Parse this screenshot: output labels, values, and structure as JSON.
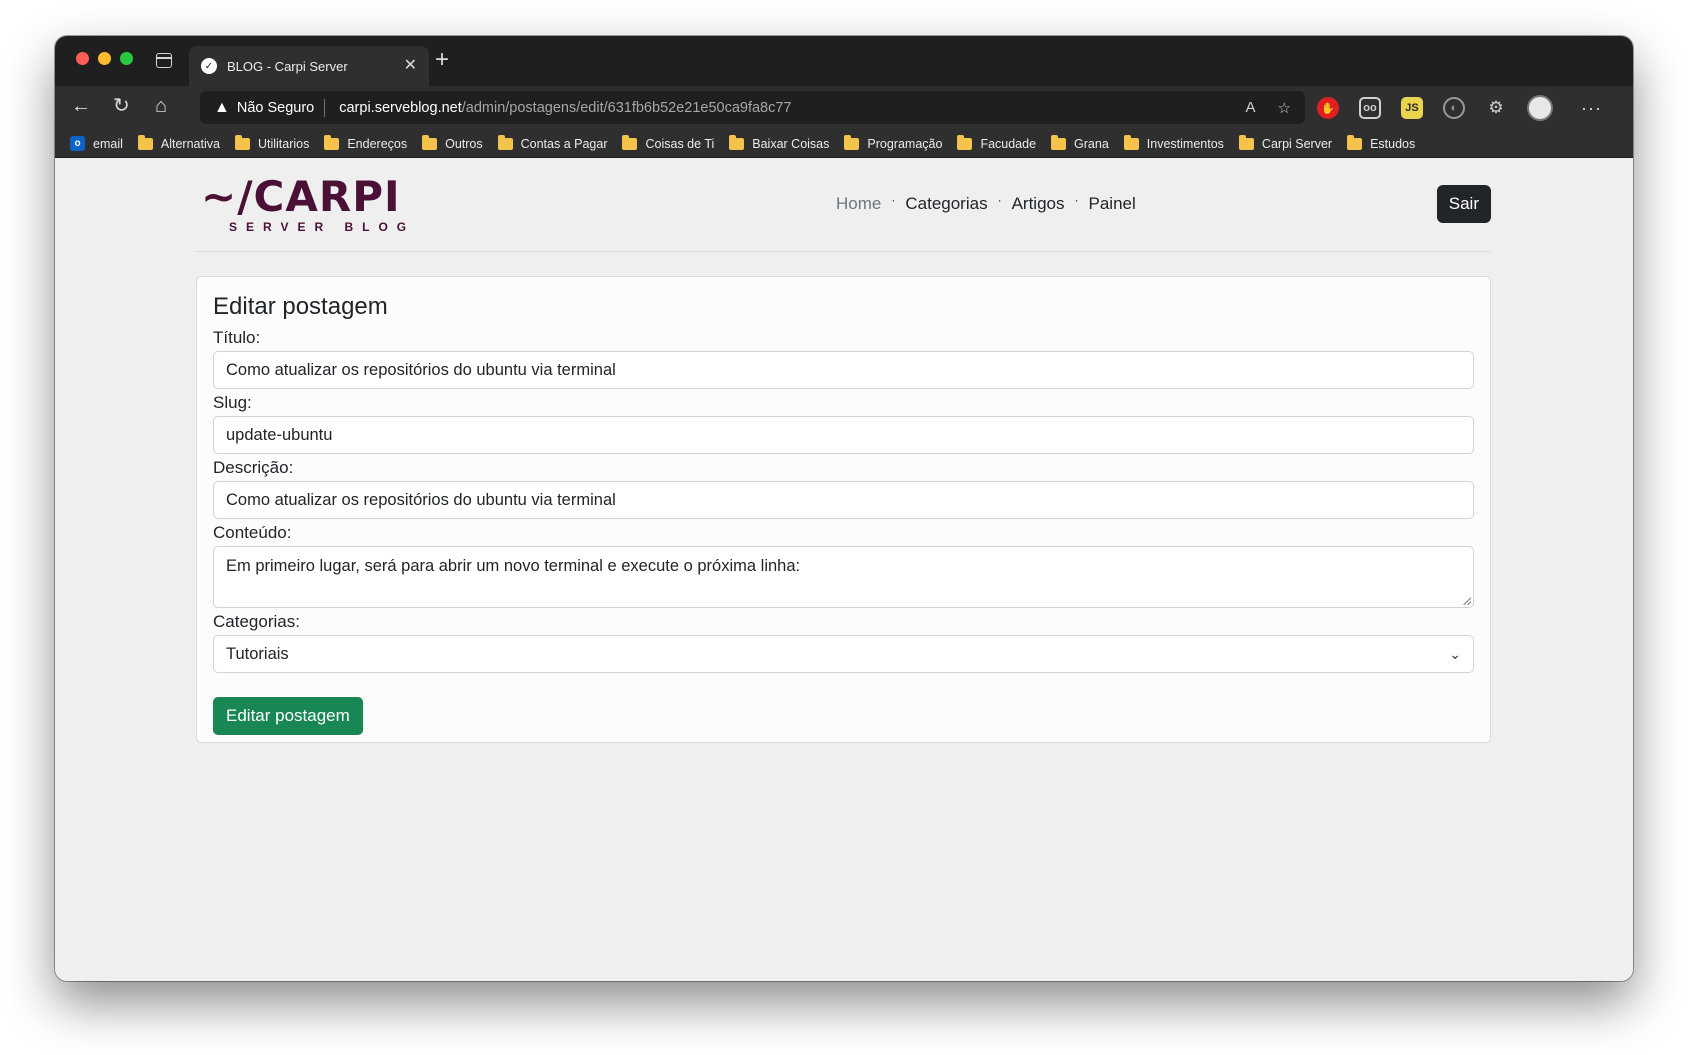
{
  "browser": {
    "tab_title": "BLOG - Carpi Server",
    "tab_favicon": "✓",
    "address": {
      "security_label": "Não Seguro",
      "url_host": "carpi.serveblog.net",
      "url_path": "/admin/postagens/edit/631fb6b52e21e50ca9fa8c77"
    },
    "extensions": {
      "ext_grey_label": "oo",
      "ext_yellow_label": "JS"
    },
    "bookmarks": [
      {
        "label": "email",
        "icon": "outlook-icon"
      },
      {
        "label": "Alternativa",
        "icon": "folder-icon"
      },
      {
        "label": "Utilitarios",
        "icon": "folder-icon"
      },
      {
        "label": "Endereços",
        "icon": "folder-icon"
      },
      {
        "label": "Outros",
        "icon": "folder-icon"
      },
      {
        "label": "Contas a Pagar",
        "icon": "folder-icon"
      },
      {
        "label": "Coisas de Ti",
        "icon": "folder-icon"
      },
      {
        "label": "Baixar Coisas",
        "icon": "folder-icon"
      },
      {
        "label": "Programação",
        "icon": "folder-icon"
      },
      {
        "label": "Facudade",
        "icon": "folder-icon"
      },
      {
        "label": "Grana",
        "icon": "folder-icon"
      },
      {
        "label": "Investimentos",
        "icon": "folder-icon"
      },
      {
        "label": "Carpi Server",
        "icon": "folder-icon"
      },
      {
        "label": "Estudos",
        "icon": "folder-icon"
      }
    ]
  },
  "site": {
    "logo_main": "~/CARPI",
    "logo_sub": "SERVER BLOG",
    "nav": [
      "Home",
      "Categorias",
      "Artigos",
      "Painel"
    ],
    "nav_separator": "·",
    "logout_label": "Sair"
  },
  "form": {
    "title": "Editar postagem",
    "titulo_label": "Título:",
    "titulo_value": "Como atualizar os repositórios do ubuntu via terminal",
    "slug_label": "Slug:",
    "slug_value": "update-ubuntu",
    "descricao_label": "Descrição:",
    "descricao_value": "Como atualizar os repositórios do ubuntu via terminal",
    "conteudo_label": "Conteúdo:",
    "conteudo_value": "Em primeiro lugar, será para abrir um novo terminal e execute o próxima linha:",
    "categorias_label": "Categorias:",
    "categorias_selected": "Tutoriais",
    "submit_label": "Editar postagem"
  },
  "colors": {
    "brand": "#4a1036",
    "submit": "#198754",
    "logout": "#212529"
  }
}
